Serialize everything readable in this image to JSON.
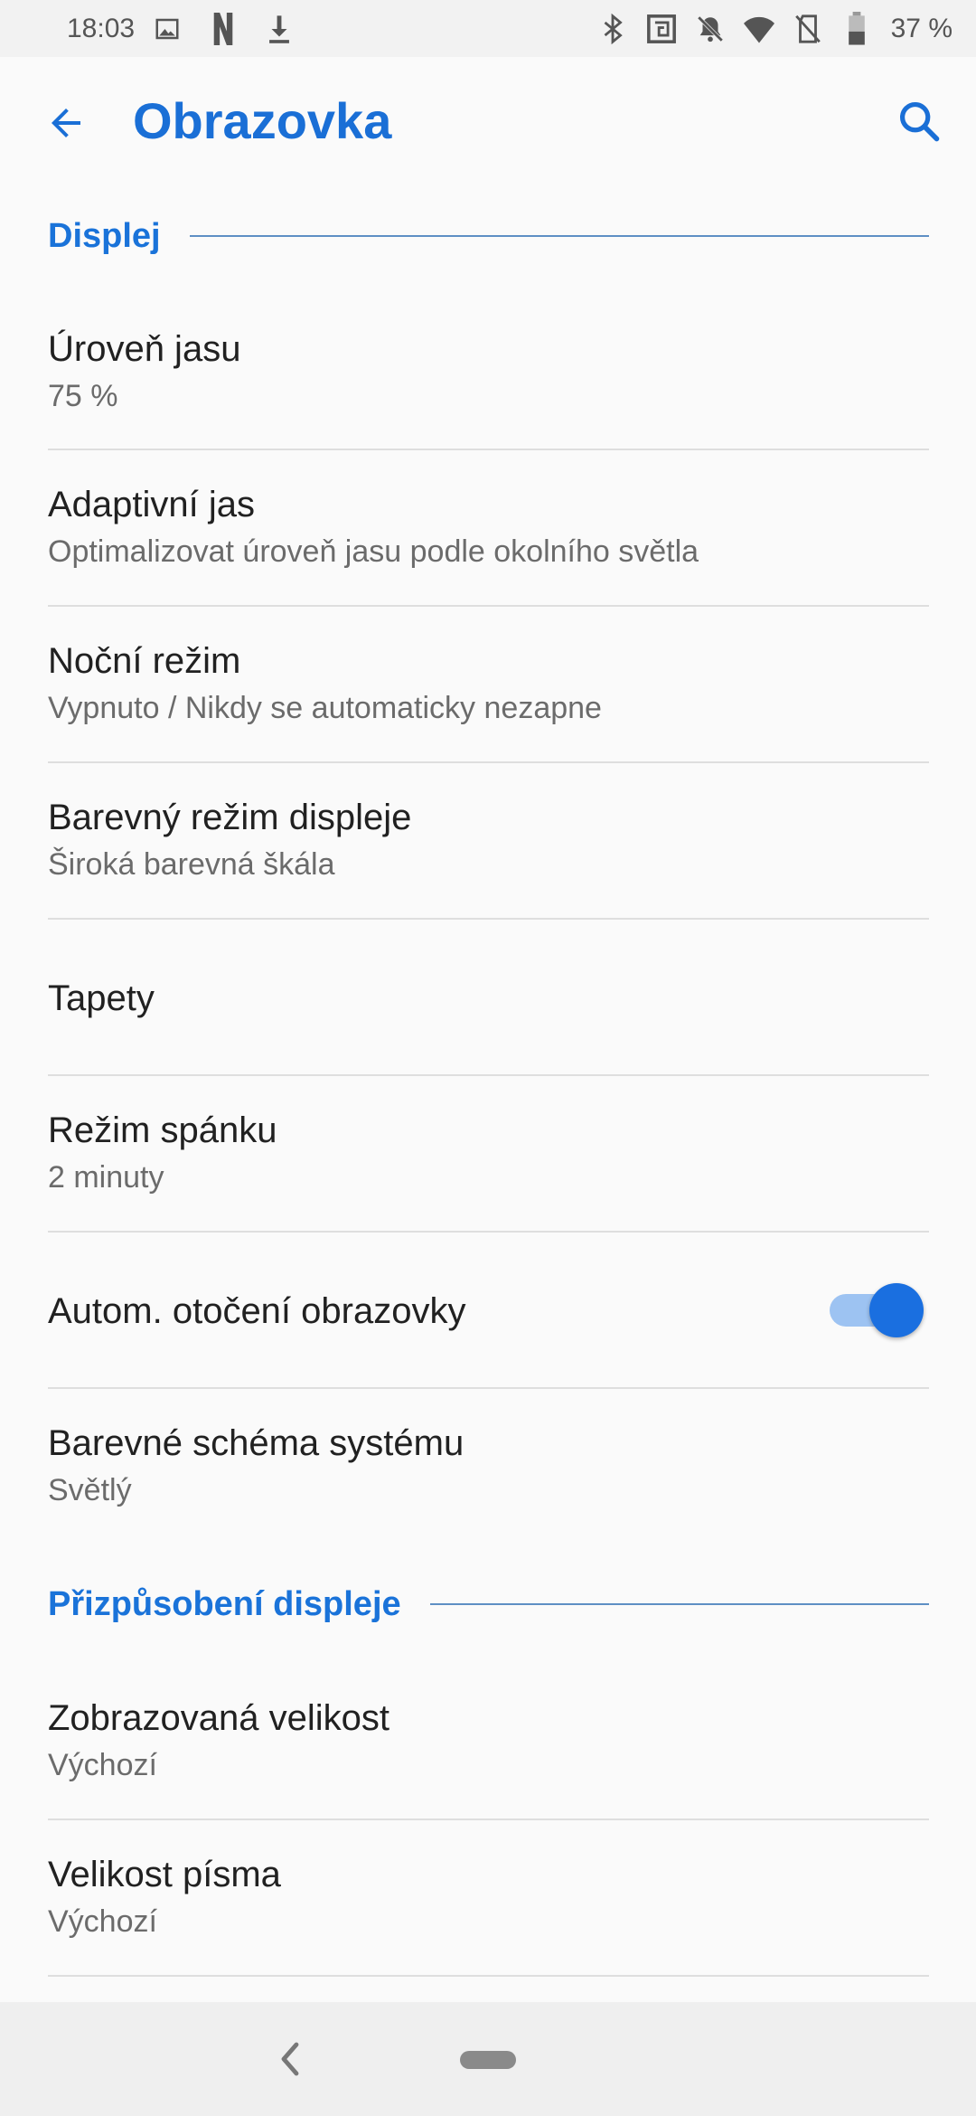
{
  "status_bar": {
    "time": "18:03",
    "left_icons": [
      "image-icon",
      "netflix-icon",
      "download-icon"
    ],
    "right_icons": [
      "bluetooth-icon",
      "nfc-icon",
      "mute-icon",
      "wifi-icon",
      "no-sim-icon",
      "battery-icon"
    ],
    "battery_percent": "37 %"
  },
  "app_bar": {
    "title": "Obrazovka",
    "back_icon": "arrow-back-icon",
    "search_icon": "search-icon"
  },
  "sections": [
    {
      "header": "Displej",
      "items": [
        {
          "title": "Úroveň jasu",
          "subtitle": "75 %"
        },
        {
          "title": "Adaptivní jas",
          "subtitle": "Optimalizovat úroveň jasu podle okolního světla"
        },
        {
          "title": "Noční režim",
          "subtitle": "Vypnuto / Nikdy se automaticky nezapne"
        },
        {
          "title": "Barevný režim displeje",
          "subtitle": "Široká barevná škála"
        },
        {
          "title": "Tapety"
        },
        {
          "title": "Režim spánku",
          "subtitle": "2 minuty"
        },
        {
          "title": "Autom. otočení obrazovky",
          "toggle": true
        },
        {
          "title": "Barevné schéma systému",
          "subtitle": "Světlý"
        }
      ]
    },
    {
      "header": "Přizpůsobení displeje",
      "items": [
        {
          "title": "Zobrazovaná velikost",
          "subtitle": "Výchozí"
        },
        {
          "title": "Velikost písma",
          "subtitle": "Výchozí"
        }
      ]
    }
  ],
  "colors": {
    "accent": "#1a6fd6",
    "toggle_thumb": "#1a6fe0",
    "toggle_track": "#9dc3f2",
    "background": "#fafafa"
  },
  "nav_bar": {
    "back_icon": "nav-back-icon",
    "home_icon": "nav-home-pill-icon"
  }
}
